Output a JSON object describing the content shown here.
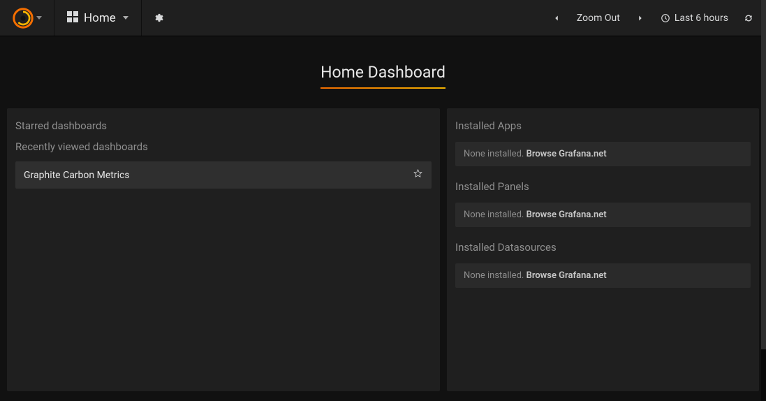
{
  "navbar": {
    "home_label": "Home",
    "zoom_out": "Zoom Out",
    "time_range": "Last 6 hours"
  },
  "title": "Home Dashboard",
  "left": {
    "starred_header": "Starred dashboards",
    "recent_header": "Recently viewed dashboards",
    "recent_items": [
      {
        "name": "Graphite Carbon Metrics"
      }
    ]
  },
  "right": {
    "apps_header": "Installed Apps",
    "panels_header": "Installed Panels",
    "datasources_header": "Installed Datasources",
    "none_text": "None installed. ",
    "browse_text": "Browse Grafana.net"
  }
}
